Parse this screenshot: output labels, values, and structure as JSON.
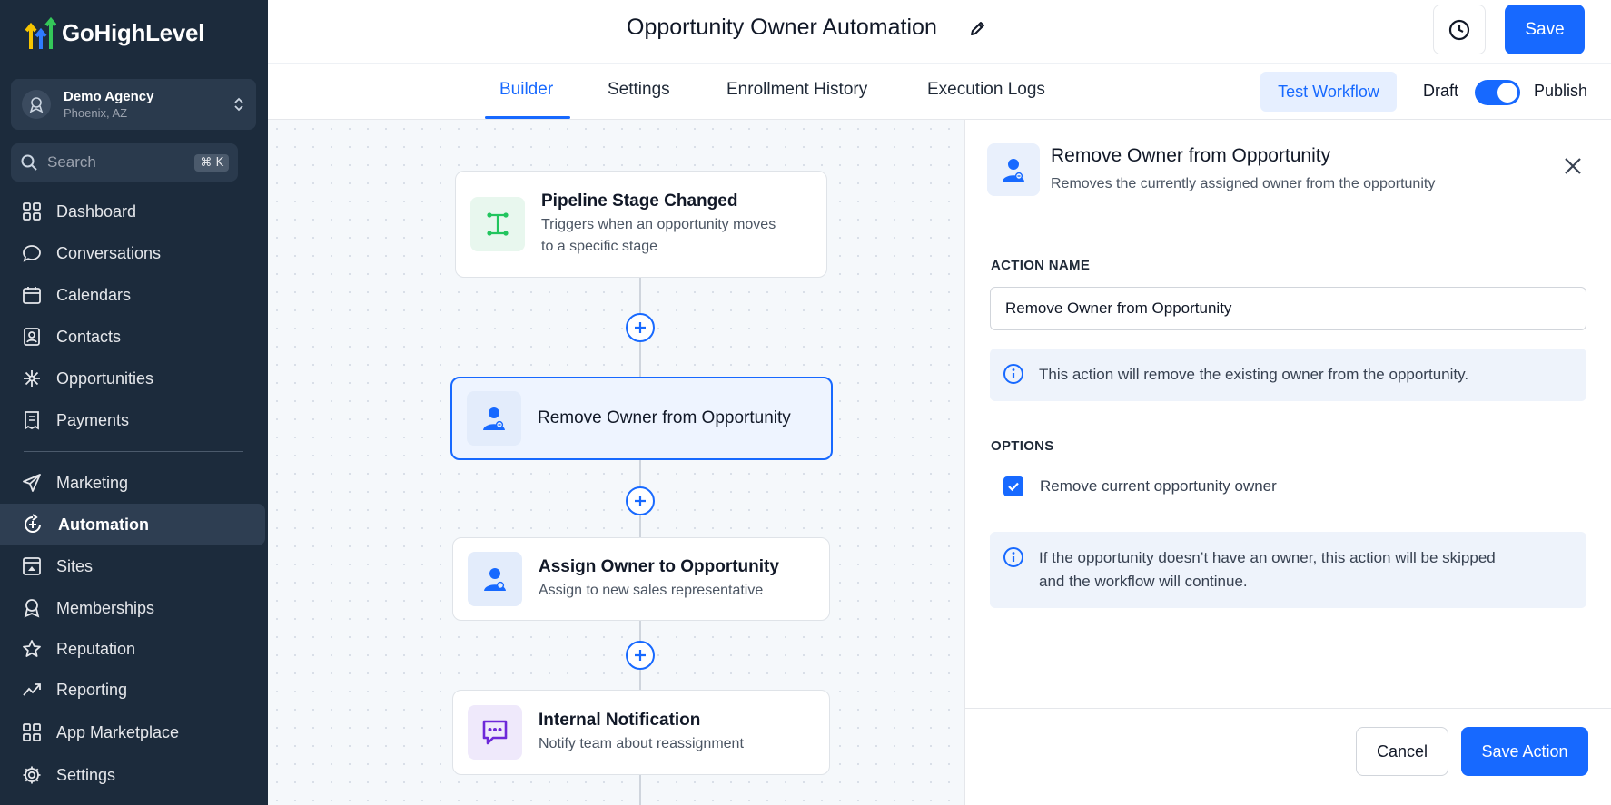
{
  "app": {
    "name": "GoHighLevel"
  },
  "agency": {
    "name": "Demo Agency",
    "location": "Phoenix, AZ"
  },
  "search": {
    "placeholder": "Search",
    "shortcut": "⌘ K"
  },
  "sidebar": {
    "items": [
      {
        "label": "Dashboard",
        "icon": "dashboard-icon"
      },
      {
        "label": "Conversations",
        "icon": "chat-bubble-icon"
      },
      {
        "label": "Calendars",
        "icon": "calendar-icon"
      },
      {
        "label": "Contacts",
        "icon": "contact-card-icon"
      },
      {
        "label": "Opportunities",
        "icon": "opportunities-icon"
      },
      {
        "label": "Payments",
        "icon": "receipt-icon"
      },
      {
        "label": "Marketing",
        "icon": "send-icon"
      },
      {
        "label": "Automation",
        "icon": "automation-icon",
        "active": true
      },
      {
        "label": "Sites",
        "icon": "sites-icon"
      },
      {
        "label": "Memberships",
        "icon": "membership-badge-icon"
      },
      {
        "label": "Reputation",
        "icon": "star-icon"
      },
      {
        "label": "Reporting",
        "icon": "trend-icon"
      },
      {
        "label": "App Marketplace",
        "icon": "grid-icon"
      },
      {
        "label": "Settings",
        "icon": "gear-icon"
      }
    ]
  },
  "header": {
    "title": "Opportunity Owner Automation",
    "save_label": "Save"
  },
  "tabs": [
    {
      "label": "Builder",
      "active": true
    },
    {
      "label": "Settings"
    },
    {
      "label": "Enrollment History"
    },
    {
      "label": "Execution Logs"
    }
  ],
  "toolbar": {
    "test_label": "Test Workflow",
    "draft_label": "Draft",
    "publish_label": "Publish",
    "publish_on": true
  },
  "workflow": {
    "nodes": [
      {
        "title": "Pipeline Stage Changed",
        "subtitle_line1": "Triggers when an opportunity moves",
        "subtitle_line2": "to a specific stage",
        "icon": "pipeline-stage-icon"
      },
      {
        "title": "Remove Owner from Opportunity",
        "icon": "user-remove-icon",
        "selected": true
      },
      {
        "title": "Assign Owner to Opportunity",
        "subtitle": "Assign to new sales representative",
        "icon": "user-assign-icon"
      },
      {
        "title": "Internal Notification",
        "subtitle": "Notify team about reassignment",
        "icon": "notification-chat-icon"
      }
    ]
  },
  "panel": {
    "title": "Remove Owner from Opportunity",
    "subtitle": "Removes the currently assigned owner from the opportunity",
    "action_name_label": "ACTION NAME",
    "action_name_value": "Remove Owner from Opportunity",
    "info_text": "This action will remove the existing owner from the opportunity.",
    "options_label": "OPTIONS",
    "option_label": "Remove current opportunity owner",
    "option_checked": true,
    "note_line1": "If the opportunity doesn’t have an owner, this action will be skipped",
    "note_line2": "and the workflow will continue.",
    "cancel_label": "Cancel",
    "save_label": "Save Action"
  },
  "colors": {
    "accent": "#1769ff",
    "sidebar_bg": "#1c2b3c",
    "trigger_green": "#22c55e",
    "notify_purple": "#6d28d9"
  }
}
